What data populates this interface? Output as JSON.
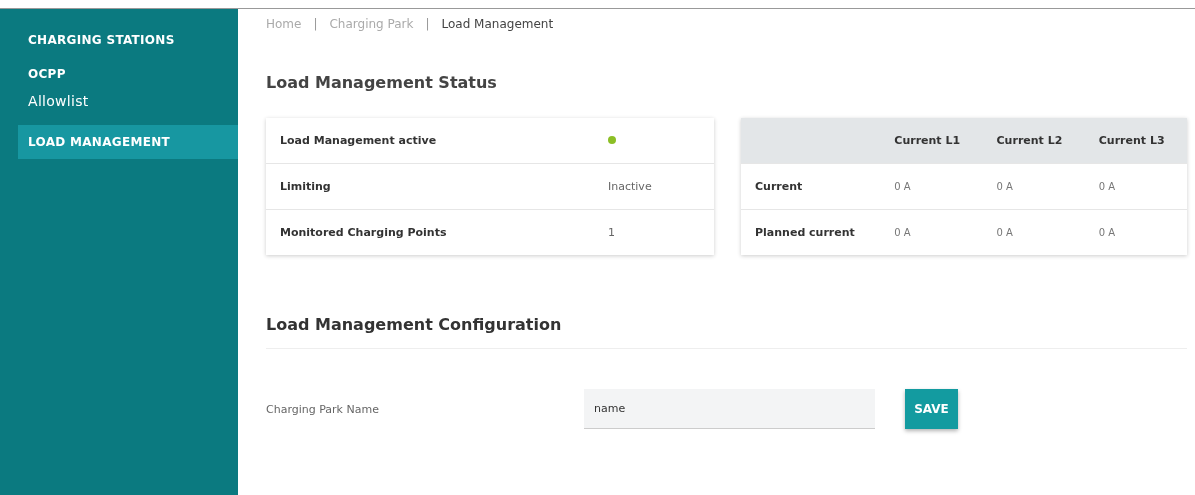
{
  "sidebar": {
    "items": [
      {
        "label": "CHARGING STATIONS",
        "kind": "caps",
        "selected": false
      },
      {
        "label": "OCPP",
        "kind": "caps",
        "selected": false
      },
      {
        "label": "Allowlist",
        "kind": "plain",
        "selected": false
      },
      {
        "label": "LOAD MANAGEMENT",
        "kind": "caps",
        "selected": true
      }
    ]
  },
  "breadcrumb": [
    {
      "label": "Home",
      "current": false
    },
    {
      "label": "Charging Park",
      "current": false
    },
    {
      "label": "Load Management",
      "current": true
    }
  ],
  "breadcrumb_separators": [
    "|",
    "|"
  ],
  "status": {
    "title": "Load Management Status",
    "summary_rows": [
      {
        "label": "Load Management active",
        "kind": "indicator",
        "active": true
      },
      {
        "label": "Limiting",
        "kind": "text",
        "value": "Inactive"
      },
      {
        "label": "Monitored Charging Points",
        "kind": "text",
        "value": "1"
      }
    ],
    "currents": {
      "columns": [
        "Current L1",
        "Current L2",
        "Current L3"
      ],
      "rows": [
        {
          "label": "Current",
          "values": [
            "0 A",
            "0 A",
            "0 A"
          ]
        },
        {
          "label": "Planned current",
          "values": [
            "0 A",
            "0 A",
            "0 A"
          ]
        }
      ]
    }
  },
  "configuration": {
    "title": "Load Management Configuration",
    "field_label": "Charging Park Name",
    "field_value": "name",
    "save_button": "SAVE"
  }
}
